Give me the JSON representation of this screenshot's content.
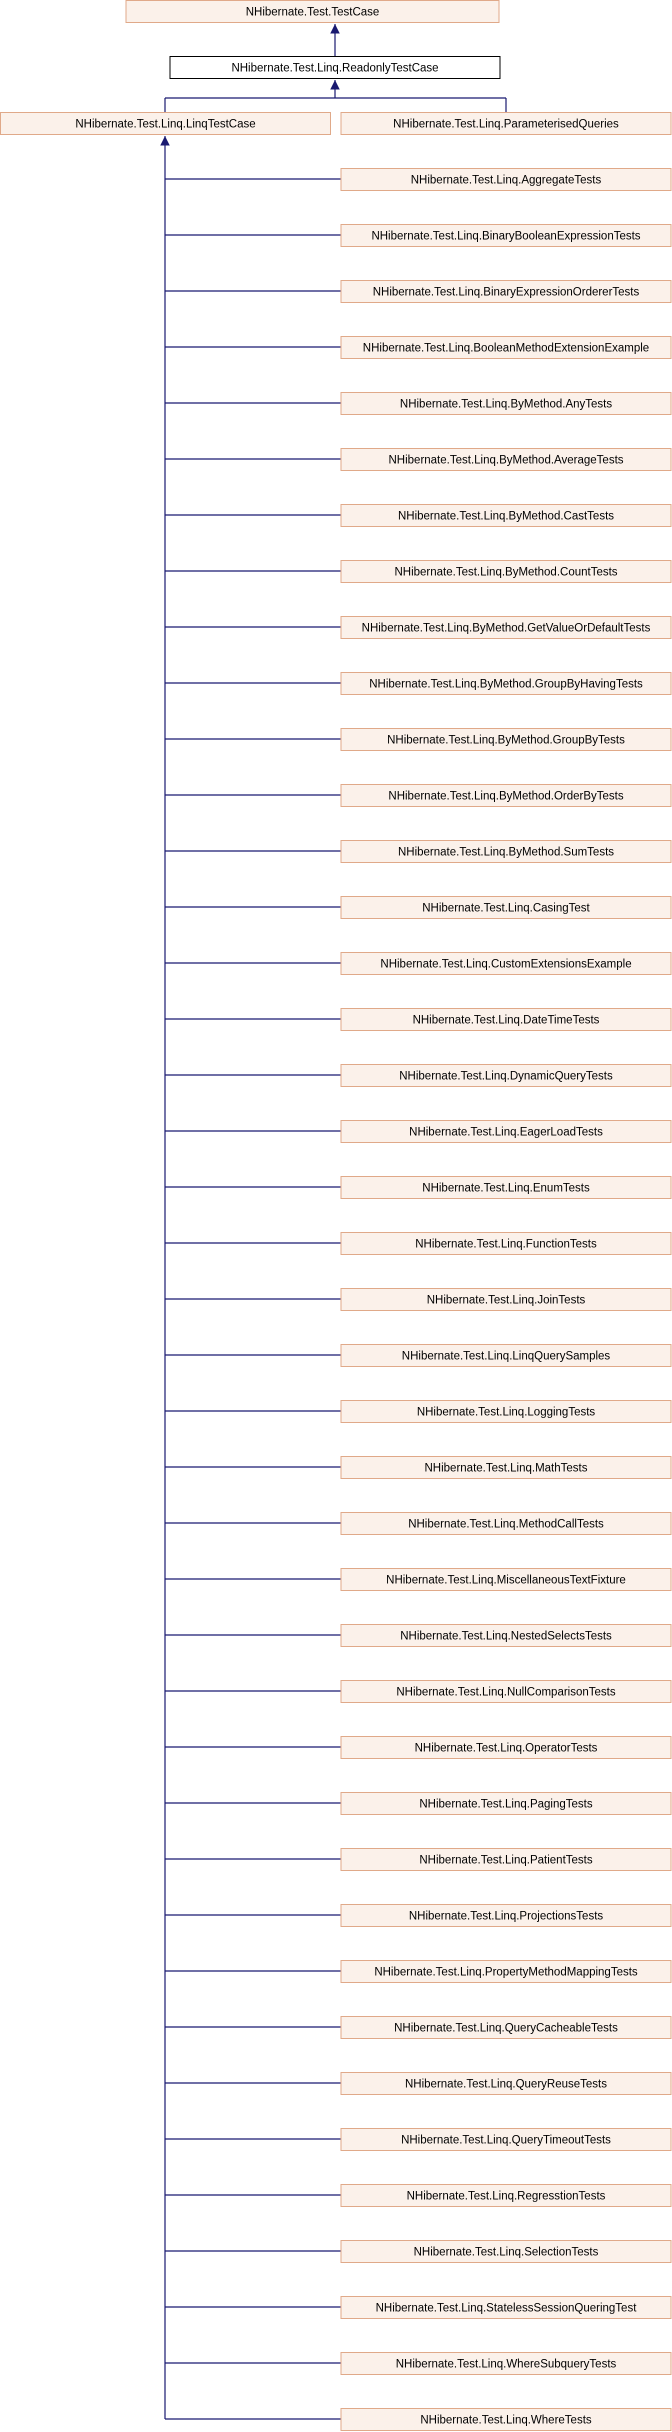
{
  "colors": {
    "node_fill": "#fbf1ea",
    "node_border": "#e0a989",
    "focus_fill": "#ffffff",
    "focus_border": "#000000",
    "edge": "#191970",
    "text": "#000000"
  },
  "nodes": {
    "test_case": {
      "label": "NHibernate.Test.TestCase",
      "icon": ""
    },
    "readonly_test_case": {
      "label": "NHibernate.Test.Linq.ReadonlyTestCase"
    },
    "linq_test_case": {
      "label": "NHibernate.Test.Linq.LinqTestCase"
    },
    "parameterised_queries": {
      "label": "NHibernate.Test.Linq.ParameterisedQueries"
    }
  },
  "derived_classes": [
    "NHibernate.Test.Linq.AggregateTests",
    "NHibernate.Test.Linq.BinaryBooleanExpressionTests",
    "NHibernate.Test.Linq.BinaryExpressionOrdererTests",
    "NHibernate.Test.Linq.BooleanMethodExtensionExample",
    "NHibernate.Test.Linq.ByMethod.AnyTests",
    "NHibernate.Test.Linq.ByMethod.AverageTests",
    "NHibernate.Test.Linq.ByMethod.CastTests",
    "NHibernate.Test.Linq.ByMethod.CountTests",
    "NHibernate.Test.Linq.ByMethod.GetValueOrDefaultTests",
    "NHibernate.Test.Linq.ByMethod.GroupByHavingTests",
    "NHibernate.Test.Linq.ByMethod.GroupByTests",
    "NHibernate.Test.Linq.ByMethod.OrderByTests",
    "NHibernate.Test.Linq.ByMethod.SumTests",
    "NHibernate.Test.Linq.CasingTest",
    "NHibernate.Test.Linq.CustomExtensionsExample",
    "NHibernate.Test.Linq.DateTimeTests",
    "NHibernate.Test.Linq.DynamicQueryTests",
    "NHibernate.Test.Linq.EagerLoadTests",
    "NHibernate.Test.Linq.EnumTests",
    "NHibernate.Test.Linq.FunctionTests",
    "NHibernate.Test.Linq.JoinTests",
    "NHibernate.Test.Linq.LinqQuerySamples",
    "NHibernate.Test.Linq.LoggingTests",
    "NHibernate.Test.Linq.MathTests",
    "NHibernate.Test.Linq.MethodCallTests",
    "NHibernate.Test.Linq.MiscellaneousTextFixture",
    "NHibernate.Test.Linq.NestedSelectsTests",
    "NHibernate.Test.Linq.NullComparisonTests",
    "NHibernate.Test.Linq.OperatorTests",
    "NHibernate.Test.Linq.PagingTests",
    "NHibernate.Test.Linq.PatientTests",
    "NHibernate.Test.Linq.ProjectionsTests",
    "NHibernate.Test.Linq.PropertyMethodMappingTests",
    "NHibernate.Test.Linq.QueryCacheableTests",
    "NHibernate.Test.Linq.QueryReuseTests",
    "NHibernate.Test.Linq.QueryTimeoutTests",
    "NHibernate.Test.Linq.RegresstionTests",
    "NHibernate.Test.Linq.SelectionTests",
    "NHibernate.Test.Linq.StatelessSessionQueringTest",
    "NHibernate.Test.Linq.WhereSubqueryTests",
    "NHibernate.Test.Linq.WhereTests"
  ]
}
